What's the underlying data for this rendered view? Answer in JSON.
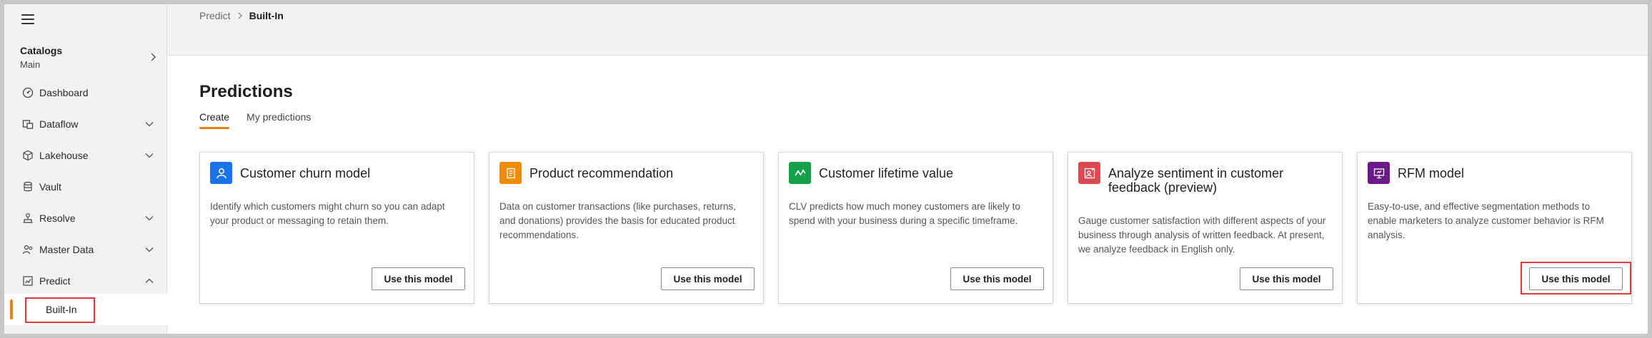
{
  "sidebar": {
    "catalogs_title": "Catalogs",
    "catalogs_value": "Main",
    "items": [
      {
        "label": "Dashboard",
        "icon": "dashboard-icon"
      },
      {
        "label": "Dataflow",
        "icon": "dataflow-icon"
      },
      {
        "label": "Lakehouse",
        "icon": "lakehouse-icon"
      },
      {
        "label": "Vault",
        "icon": "database-icon"
      },
      {
        "label": "Resolve",
        "icon": "resolve-icon"
      },
      {
        "label": "Master Data",
        "icon": "master-data-icon"
      },
      {
        "label": "Predict",
        "icon": "predict-icon"
      }
    ],
    "sub_item": "Built-In"
  },
  "breadcrumb": {
    "parent": "Predict",
    "current": "Built-In"
  },
  "page": {
    "title": "Predictions",
    "tabs": [
      "Create",
      "My predictions"
    ]
  },
  "cards": [
    {
      "title": "Customer churn model",
      "description": "Identify which customers might churn so you can adapt your product or messaging to retain them.",
      "button": "Use this model",
      "icon": "person-icon",
      "color": "#1a73e8"
    },
    {
      "title": "Product recommendation",
      "description": "Data on customer transactions (like purchases, returns, and donations) provides the basis for educated product recommendations.",
      "button": "Use this model",
      "icon": "document-list-icon",
      "color": "#f08a00"
    },
    {
      "title": "Customer lifetime value",
      "description": "CLV predicts how much money customers are likely to spend with your business during a specific timeframe.",
      "button": "Use this model",
      "icon": "trend-icon",
      "color": "#13a049"
    },
    {
      "title": "Analyze sentiment in customer feedback (preview)",
      "description": "Gauge customer satisfaction with different aspects of your business through analysis of written feedback. At present, we analyze feedback in English only.",
      "button": "Use this model",
      "icon": "feedback-icon",
      "color": "#d94a52"
    },
    {
      "title": "RFM model",
      "description": "Easy-to-use, and effective segmentation methods to enable marketers to analyze customer behavior is RFM analysis.",
      "button": "Use this model",
      "icon": "presentation-icon",
      "color": "#6c1a8a"
    }
  ],
  "colors": {
    "accent": "#e8820c",
    "highlight": "#e03c3c"
  }
}
